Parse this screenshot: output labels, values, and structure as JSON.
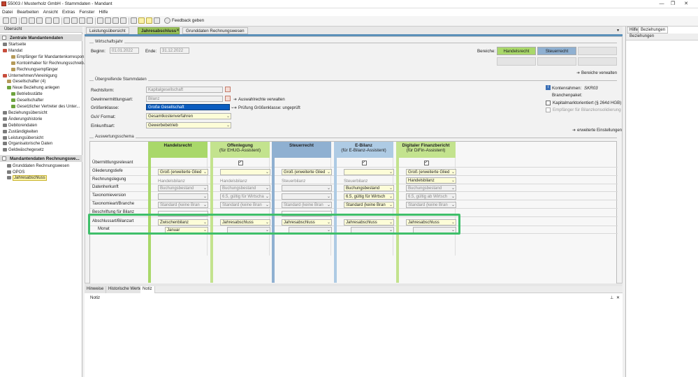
{
  "window": {
    "title": "55003 / Musterholz GmbH - Stammdaten - Mandant",
    "controls": [
      "—",
      "❐",
      "✕"
    ]
  },
  "menu": [
    "Datei",
    "Bearbeiten",
    "Ansicht",
    "Extras",
    "Fenster",
    "Hilfe"
  ],
  "toolbar": {
    "feedback": "Feedback geben"
  },
  "left": {
    "header": "Übersicht",
    "section1": "Zentrale Mandantendaten",
    "items1": [
      {
        "label": "Startseite",
        "icon": "page-icon",
        "indent": 0
      },
      {
        "label": "Mandat",
        "icon": "folder-icon",
        "indent": 0
      },
      {
        "label": "Empfänger für Mandantenkorrespon...",
        "icon": "link-icon",
        "indent": 2
      },
      {
        "label": "Kontoinhaber für Rechnungsschreib...",
        "icon": "link-icon",
        "indent": 2
      },
      {
        "label": "Rechnungsempfänger",
        "icon": "link-icon",
        "indent": 2
      },
      {
        "label": "Unternehmen/Vereinigung",
        "icon": "folder-icon",
        "indent": 0
      },
      {
        "label": "Gesellschafter (4)",
        "icon": "link-icon",
        "indent": 1
      },
      {
        "label": "Neue Beziehung anlegen",
        "icon": "plus-icon",
        "indent": 1
      },
      {
        "label": "Betriebsstätte",
        "icon": "plus-icon",
        "indent": 2
      },
      {
        "label": "Gesellschafter",
        "icon": "plus-icon",
        "indent": 2
      },
      {
        "label": "Gesetzlicher Vertreter des Unter...",
        "icon": "plus-icon",
        "indent": 2
      },
      {
        "label": "Beziehungsübersicht",
        "icon": "page-icon",
        "indent": 0
      },
      {
        "label": "Änderungshistorie",
        "icon": "page-icon",
        "indent": 0
      },
      {
        "label": "Debitorendaten",
        "icon": "page-icon",
        "indent": 0
      },
      {
        "label": "Zuständigkeiten",
        "icon": "page-icon",
        "indent": 0
      },
      {
        "label": "Leistungsübersicht",
        "icon": "page-icon",
        "indent": 0
      },
      {
        "label": "Organisatorische Daten",
        "icon": "page-icon",
        "indent": 0
      },
      {
        "label": "Geldwäschegesetz",
        "icon": "page-icon",
        "indent": 0
      }
    ],
    "section2": "Mandantendaten Rechnungswe...",
    "items2": [
      {
        "label": "Grunddaten Rechnungswesen",
        "icon": "page-icon"
      },
      {
        "label": "OPOS",
        "icon": "page-icon"
      },
      {
        "label": "Jahresabschluss",
        "icon": "page-icon",
        "selected": true
      }
    ]
  },
  "tabs": [
    {
      "label": "Leistungsübersicht",
      "active": false
    },
    {
      "label": "Jahresabschluss",
      "active": true
    },
    {
      "label": "Grunddaten Rechnungswesen",
      "active": false
    }
  ],
  "wirtschaftsjahr": {
    "group": "Wirtschaftsjahr",
    "begin_label": "Beginn:",
    "begin": "01.01.2022",
    "end_label": "Ende:",
    "end": "31.12.2022",
    "bereiche_label": "Bereiche:",
    "bereiche": [
      "Handelsrecht",
      "Steuerrecht"
    ],
    "bereiche_link": "Bereiche verwalten"
  },
  "stammdaten": {
    "group": "Übergreifende Stammdaten",
    "rows": [
      {
        "label": "Rechtsform:",
        "value": "Kapitalgesellschaft"
      },
      {
        "label": "Gewinnermittlungsart:",
        "value": "Bilanz"
      },
      {
        "label": "Größenklasse:",
        "value": "Große Gesellschaft"
      },
      {
        "label": "GuV Format:",
        "value": "Gesamtkostenverfahren"
      },
      {
        "label": "Einkunftsart:",
        "value": "Gewerbebetrieb"
      }
    ],
    "link1": "Auswahlrechte verwalten",
    "link2": "Prüfung Größenklasse: ungeprüft",
    "kontenrahmen_label": "Kontenrahmen:",
    "kontenrahmen": "SKR03",
    "branchenpaket_label": "Branchenpaket:",
    "check1": "Kapitalmarktorientiert (§ 264d HGB)",
    "check2": "Empfänger für Bilanzkonsolidierung",
    "link3": "erweiterte Einstellungen"
  },
  "schema": {
    "group": "Auswertungsschema",
    "rows": [
      "Übermittlungsrelevant",
      "Gliederungstiefe",
      "Rechnungslegung",
      "Datenherkunft",
      "Taxonomieversion",
      "Taxonomieart/Branche",
      "Beschriftung für Bilanz",
      "Abschlussart/Bilanzart",
      "Monat"
    ],
    "columns": [
      {
        "title": "Handelsrecht",
        "sub": "",
        "color": "#a9d86a",
        "cells": [
          "",
          "Groß (erweiterte Glied",
          "Handelsbilanz",
          "Buchungsbestand",
          "",
          "Standard (keine Bran",
          "",
          "Zwischenbilanz",
          "Januar"
        ]
      },
      {
        "title": "Offenlegung",
        "sub": "(für EHUG-Assistent)",
        "color": "#c3e38e",
        "cells": [
          "✓",
          "",
          "Handelsbilanz",
          "Buchungsbestand",
          "6.5, gültig für Wirtscha",
          "Standard (keine Bran",
          "",
          "Jahresabschluss",
          ""
        ]
      },
      {
        "title": "Steuerrecht",
        "sub": "",
        "color": "#8fb0d1",
        "cells": [
          "",
          "Groß (erweiterte Glied",
          "Steuerbilanz",
          "",
          "",
          "Standard (keine Bran",
          "",
          "Jahresabschluss",
          ""
        ]
      },
      {
        "title": "E-Bilanz",
        "sub": "(für E-Bilanz-Assistent)",
        "color": "#aecbe4",
        "cells": [
          "✓",
          "",
          "Steuerbilanz",
          "Buchungsbestand",
          "6.5, gültig für Wirtsch",
          "Standard (keine Bran",
          "",
          "Jahresabschluss",
          ""
        ]
      },
      {
        "title": "Digitaler Finanzbericht",
        "sub": "(für DiFin-Assistent)",
        "color": "#c3e38e",
        "cells": [
          "✓",
          "Groß (erweiterte Glied",
          "Handelsbilanz",
          "Buchungsbestand",
          "6.5, gültig ab Wirtsch",
          "Standard (keine Bran",
          "",
          "Jahresabschluss",
          ""
        ]
      }
    ]
  },
  "bottom": {
    "tabs": [
      "Hinweise",
      "Historische Werte",
      "Notiz"
    ],
    "notiz_label": "Notiz"
  },
  "right": {
    "tabs": [
      "Hilfe",
      "Beziehungen"
    ],
    "header": "Beziehungen"
  }
}
